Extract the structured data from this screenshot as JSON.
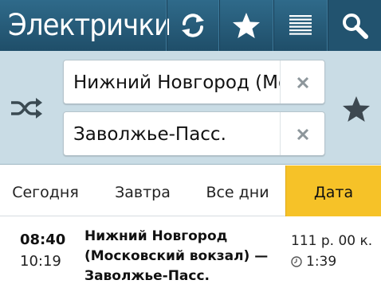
{
  "header": {
    "title": "Электрички",
    "buttons": [
      {
        "name": "refresh-icon"
      },
      {
        "name": "star-icon"
      },
      {
        "name": "list-icon"
      },
      {
        "name": "search-icon"
      }
    ],
    "color": "#2a5f7e"
  },
  "route": {
    "from_value": "Нижний Новгород (Мо",
    "to_value": "Заволжье-Пасс.",
    "clear_icon": "close-icon",
    "swap_icon": "shuffle-icon",
    "favorite_icon": "star-icon"
  },
  "tabs": [
    {
      "label": "Сегодня",
      "selected": false
    },
    {
      "label": "Завтра",
      "selected": false
    },
    {
      "label": "Все дни",
      "selected": false
    },
    {
      "label": "Дата",
      "selected": true
    }
  ],
  "accent_color": "#f6c228",
  "train": {
    "departure": "08:40",
    "arrival": "10:19",
    "route": "Нижний Новгород (Московский вокзал) — Заволжье-Пасс.",
    "price": "111 р. 00 к.",
    "duration": "1:39"
  }
}
